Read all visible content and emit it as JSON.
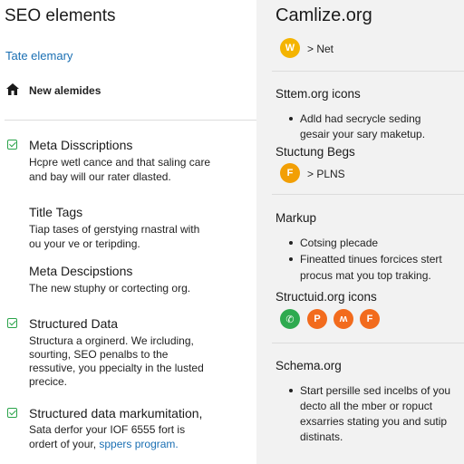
{
  "left": {
    "title": "SEO elements",
    "link": "Tate elemary",
    "nav_label": "New alemides",
    "items": [
      {
        "title": "Meta Disscriptions",
        "lines": [
          "Hcpre wetl cance and that saling care",
          "and bay will our rater dlasted."
        ],
        "checked": true
      },
      {
        "title": "Title Tags",
        "lines": [
          "Tiap tases of gerstying rnastral with",
          "ou your ve or teripding."
        ],
        "checked": false
      },
      {
        "title": "Meta Descipstions",
        "lines": [
          "The new stuphy or cortecting org."
        ],
        "checked": false
      },
      {
        "title": "Structured Data",
        "lines": [
          "Structura a orginerd. We ircluding,",
          "sourting, SEO penalbs to the",
          "ressutive, you ppecialty in the lusted",
          "precice."
        ],
        "checked": true
      },
      {
        "title": "Structured data markumitation,",
        "lines": [
          "Sata derfor your IOF 6555 fort is"
        ],
        "last_line_prefix": "ordert of your, ",
        "last_line_link": "sppers program.",
        "checked": true
      }
    ]
  },
  "right": {
    "title": "Camlize.org",
    "badge_row1": {
      "letter": "W",
      "color": "#f4b400",
      "text": "> Net"
    },
    "section1": {
      "title": "Sttem.org icons",
      "bullet": [
        "Adld had secrycle seding",
        "gesair your sary maketup."
      ]
    },
    "section2": {
      "title": "Stuctung Begs",
      "badge": {
        "letter": "F",
        "color": "#f29f05"
      },
      "text": "> PLNS"
    },
    "section3": {
      "title": "Markup",
      "bullets": [
        [
          "Cotsing plecade"
        ],
        [
          "Fineatted tinues forcices stert",
          "procus mat you top traking."
        ]
      ]
    },
    "section4": {
      "title": "Structuid.org icons",
      "icons": [
        {
          "letter": "✆",
          "color": "#2eaa4f",
          "name": "whatsapp-icon"
        },
        {
          "letter": "P",
          "color": "#f26b1d",
          "name": "p-badge-icon"
        },
        {
          "letter": "ʍ",
          "color": "#f26b1d",
          "name": "crown-badge-icon"
        },
        {
          "letter": "F",
          "color": "#f26b1d",
          "name": "f-badge-icon"
        }
      ]
    },
    "section5": {
      "title": "Schema.org",
      "bullet": [
        "Start persille sed incelbs of you",
        "decto all the mber or ropuct",
        "exsarries stating you and sutip",
        "distinats."
      ]
    }
  }
}
